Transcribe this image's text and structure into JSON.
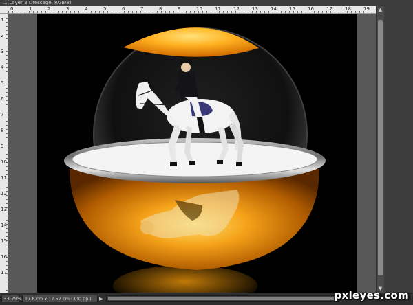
{
  "window": {
    "tab_title": "...(Layer 3 Dressage, RGB/8)"
  },
  "ruler_top": {
    "labels": [
      "0",
      "1",
      "2",
      "3",
      "4",
      "5",
      "6",
      "7",
      "8",
      "9",
      "10",
      "11",
      "12",
      "13",
      "14",
      "15",
      "16",
      "17",
      "18",
      "19"
    ]
  },
  "ruler_left": {
    "labels": [
      "1",
      "2",
      "3",
      "4",
      "5",
      "6",
      "7",
      "8",
      "9",
      "10",
      "11",
      "12",
      "13",
      "14",
      "15",
      "16",
      "17"
    ]
  },
  "status": {
    "zoom": "33.29%",
    "doc_info": "17.8 cm x 17.52 cm (300 ppi)",
    "info_arrow": "▶"
  },
  "watermark": "pxleyes.com",
  "icons": {
    "scroll_up": "▲",
    "scroll_down": "▼"
  }
}
